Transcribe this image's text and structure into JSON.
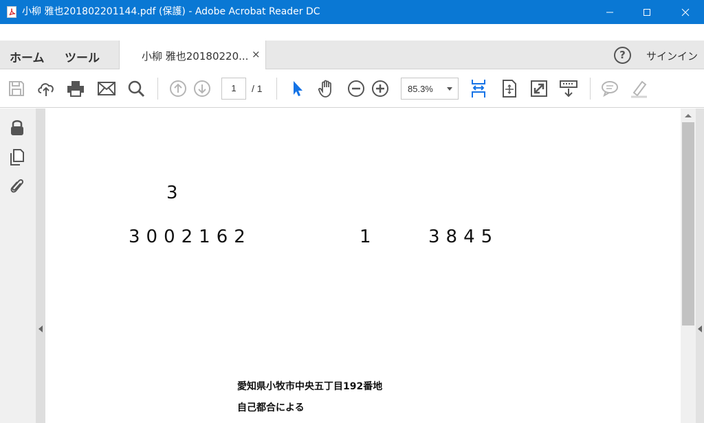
{
  "window": {
    "title": "小柳 雅也201802201144.pdf (保護) - Adobe Acrobat Reader DC",
    "controls": {
      "minimize": "minimize-icon",
      "maximize": "maximize-icon",
      "close": "close-icon"
    }
  },
  "nav": {
    "home": "ホーム",
    "tools": "ツール"
  },
  "tab": {
    "label": "小柳 雅也20180220...",
    "close": "×"
  },
  "header": {
    "help": "?",
    "signin": "サインイン"
  },
  "toolbar": {
    "page_current": "1",
    "page_total": "/ 1",
    "zoom": "85.3%",
    "icons": [
      "save-icon",
      "upload-cloud-icon",
      "print-icon",
      "email-icon",
      "search-icon",
      "prev-page-icon",
      "next-page-icon",
      "select-arrow-icon",
      "hand-icon",
      "zoom-out-icon",
      "zoom-in-icon",
      "fit-width-icon",
      "fit-page-icon",
      "fullscreen-icon",
      "read-mode-icon",
      "comment-icon",
      "highlight-icon"
    ]
  },
  "colors": {
    "titlebar": "#0a78d4",
    "accent_blue": "#1473e6"
  },
  "document": {
    "line1": "3",
    "line2a": "3002162",
    "line2b": "1",
    "line2c": "3845",
    "address": "愛知県小牧市中央五丁目192番地",
    "reason": "自己都合による"
  }
}
